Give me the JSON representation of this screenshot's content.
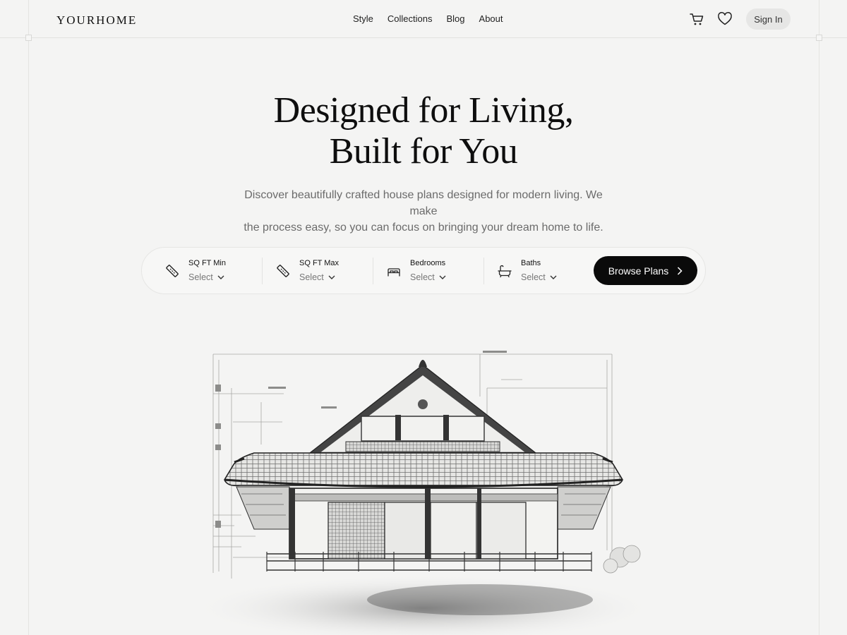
{
  "header": {
    "logo": "YOURHOME",
    "nav": [
      "Style",
      "Collections",
      "Blog",
      "About"
    ],
    "signin_label": "Sign In"
  },
  "hero": {
    "title_line1": "Designed for Living,",
    "title_line2": "Built for You",
    "subtitle_line1": "Discover beautifully crafted house plans designed for modern living. We make",
    "subtitle_line2": "the process easy, so you can focus on bringing your dream home to life."
  },
  "filters": [
    {
      "label": "SQ FT Min",
      "value": "Select",
      "icon": "ruler-icon"
    },
    {
      "label": "SQ FT Max",
      "value": "Select",
      "icon": "ruler-icon"
    },
    {
      "label": "Bedrooms",
      "value": "Select",
      "icon": "bed-icon"
    },
    {
      "label": "Baths",
      "value": "Select",
      "icon": "bathtub-icon"
    }
  ],
  "browse_label": "Browse Plans",
  "colors": {
    "accent": "#0a0a0a",
    "background": "#f4f4f3",
    "muted": "#6b6b6b"
  }
}
